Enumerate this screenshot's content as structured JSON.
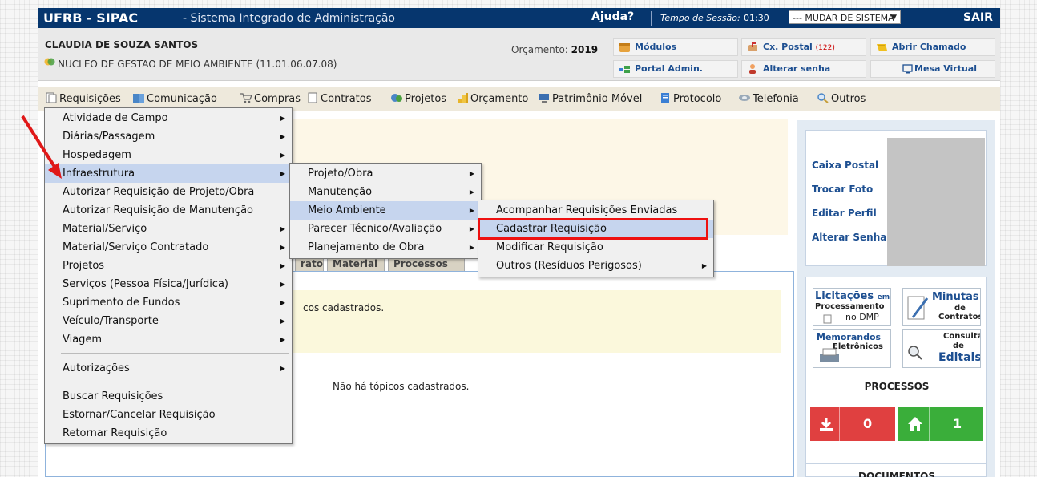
{
  "header": {
    "app_title": "UFRB - SIPAC",
    "app_subtitle": "- Sistema Integrado de Administração",
    "help": "Ajuda?",
    "session_label": "Tempo de Sessão:",
    "session_time": "01:30",
    "system_select": "--- MUDAR DE SISTEMA ---",
    "logout": "SAIR"
  },
  "user": {
    "name": "CLAUDIA DE SOUZA SANTOS",
    "unit": "NUCLEO DE GESTAO DE MEIO AMBIENTE (11.01.06.07.08)",
    "budget_label": "Orçamento:",
    "budget_year": "2019"
  },
  "quick_links": {
    "modulos": "Módulos",
    "cx_postal": "Cx. Postal",
    "cx_postal_count": "(122)",
    "abrir_chamado": "Abrir Chamado",
    "portal_admin": "Portal Admin.",
    "alterar_senha": "Alterar senha",
    "mesa_virtual": "Mesa Virtual"
  },
  "menubar": {
    "requisicoes": "Requisições",
    "comunicacao": "Comunicação",
    "compras": "Compras",
    "contratos": "Contratos",
    "projetos": "Projetos",
    "orcamento": "Orçamento",
    "patrimonio": "Patrimônio Móvel",
    "protocolo": "Protocolo",
    "telefonia": "Telefonia",
    "outros": "Outros"
  },
  "menu_level1": [
    "Atividade de Campo",
    "Diárias/Passagem",
    "Hospedagem",
    "Infraestrutura",
    "Autorizar Requisição de Projeto/Obra",
    "Autorizar Requisição de Manutenção",
    "Material/Serviço",
    "Material/Serviço Contratado",
    "Projetos",
    "Serviços (Pessoa Física/Jurídica)",
    "Suprimento de Fundos",
    "Veículo/Transporte",
    "Viagem",
    "Autorizações",
    "Buscar Requisições",
    "Estornar/Cancelar Requisição",
    "Retornar Requisição"
  ],
  "menu_level2": [
    "Projeto/Obra",
    "Manutenção",
    "Meio Ambiente",
    "Parecer Técnico/Avaliação",
    "Planejamento de Obra"
  ],
  "menu_level3": [
    "Acompanhar Requisições Enviadas",
    "Cadastrar Requisição",
    "Modificar Requisição",
    "Outros (Resíduos Perigosos)"
  ],
  "content": {
    "tabs": [
      "rato",
      "Material",
      "Processos"
    ],
    "notice_text": "cos cadastrados.",
    "no_topics": "Não há tópicos cadastrados."
  },
  "sidebar": {
    "caixa_postal": "Caixa Postal",
    "trocar_foto": "Trocar Foto",
    "editar_perfil": "Editar Perfil",
    "alterar_senha": "Alterar Senha",
    "banner_licitacoes_1": "Licitações",
    "banner_licitacoes_2": "em",
    "banner_licitacoes_3": "Processamento",
    "banner_licitacoes_4": "no DMP",
    "banner_minutas_1": "Minutas",
    "banner_minutas_2": "de",
    "banner_minutas_3": "Contratos",
    "banner_memorandos_1": "Memorandos",
    "banner_memorandos_2": "Eletrônicos",
    "banner_editais_1": "Consulta",
    "banner_editais_2": "de",
    "banner_editais_3": "Editais",
    "processos_title": "PROCESSOS",
    "processos_received": "0",
    "processos_unit": "1",
    "documentos_title": "DOCUMENTOS"
  },
  "colors": {
    "topbar": "#06366e",
    "highlight": "#e11111",
    "process_red": "#e04040",
    "process_green": "#3aae3a"
  }
}
